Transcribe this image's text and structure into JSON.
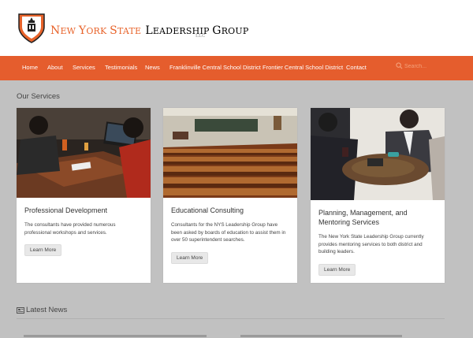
{
  "brand": {
    "title_orange": "New York State",
    "title_black": "Leadership Group",
    "llc": "LLC"
  },
  "colors": {
    "accent": "#e55d2d",
    "background": "#c1c1c1"
  },
  "nav": {
    "items": [
      "Home",
      "About",
      "Services",
      "Testimonials",
      "News",
      "Franklinville Central School District",
      "Frontier Central School District",
      "Contact"
    ],
    "search_placeholder": "Search..."
  },
  "services": {
    "heading": "Our Services",
    "cards": [
      {
        "title": "Professional Development",
        "text": "The consultants have provided numerous professional workshops and services.",
        "button": "Learn More"
      },
      {
        "title": "Educational Consulting",
        "text": "Consultants for the NYS Leadership Group have been asked by boards of education to assist them in over 50 superintendent searches.",
        "button": "Learn More"
      },
      {
        "title": "Planning, Management, and Mentoring Services",
        "text": "The New York State Leadership Group currently provides mentoring services to both district and building leaders.",
        "button": "Learn More"
      }
    ]
  },
  "news": {
    "heading": "Latest News"
  },
  "icons": {
    "logo": "shield-crest-icon",
    "search": "search-icon",
    "news": "newspaper-icon"
  }
}
